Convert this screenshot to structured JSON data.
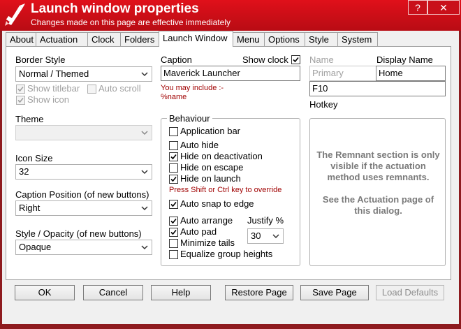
{
  "window": {
    "title": "Launch window properties",
    "subtitle": "Changes made on this page are effective immediately",
    "help_label": "?",
    "close_label": "✕"
  },
  "tabs": [
    "About",
    "Actuation",
    "Clock",
    "Folders",
    "Launch Window",
    "Menu",
    "Options",
    "Style",
    "System"
  ],
  "left": {
    "border_style_label": "Border Style",
    "border_style_value": "Normal / Themed",
    "show_titlebar": "Show titlebar",
    "auto_scroll": "Auto scroll",
    "show_icon": "Show icon",
    "theme_label": "Theme",
    "theme_value": "",
    "icon_size_label": "Icon Size",
    "icon_size_value": "32",
    "caption_position_label": "Caption Position (of new buttons)",
    "caption_position_value": "Right",
    "style_opacity_label": "Style / Opacity (of new buttons)",
    "style_opacity_value": "Opaque"
  },
  "middle": {
    "caption_label": "Caption",
    "show_clock_label": "Show clock",
    "caption_value": "Maverick Launcher",
    "may_include": "You may include :-",
    "name_token": "%name",
    "behaviour_label": "Behaviour",
    "application_bar": "Application bar",
    "auto_hide": "Auto hide",
    "hide_on_deactivation": "Hide on deactivation",
    "hide_on_escape": "Hide on escape",
    "hide_on_launch": "Hide on launch",
    "override_note": "Press Shift or Ctrl key to override",
    "auto_snap_to_edge": "Auto snap to edge",
    "auto_arrange": "Auto arrange",
    "auto_pad": "Auto pad",
    "minimize_tails": "Minimize tails",
    "equalize_group_heights": "Equalize group heights",
    "justify_label": "Justify %",
    "justify_value": "30"
  },
  "right": {
    "name_label": "Name",
    "display_name_label": "Display Name",
    "primary_label": "Primary",
    "home_value": "Home",
    "hotkey_value": "F10",
    "hotkey_label": "Hotkey",
    "remnant_note": "The Remnant section is only visible if the actuation method uses remnants.",
    "actuation_note": "See the Actuation page of this dialog."
  },
  "buttons": {
    "ok": "OK",
    "cancel": "Cancel",
    "help": "Help",
    "restore_page": "Restore Page",
    "save_page": "Save Page",
    "load_defaults": "Load Defaults"
  },
  "colors": {
    "titlebar": "#d90f18",
    "frame": "#8e1b1f",
    "accent_red_text": "#a00000"
  }
}
